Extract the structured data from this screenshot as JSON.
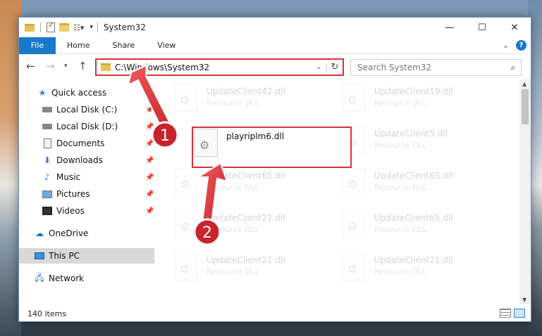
{
  "window": {
    "title": "System32",
    "controls": {
      "minimize": "—",
      "maximize": "☐",
      "close": "✕"
    }
  },
  "ribbon": {
    "file_tab": "File",
    "tabs": [
      "Home",
      "Share",
      "View"
    ],
    "help": "?"
  },
  "nav": {
    "address": "C:\\Windows\\System32",
    "search_placeholder": "Search System32"
  },
  "sidebar": {
    "items": [
      {
        "label": "Quick access",
        "icon": "star-icon",
        "pinned": false
      },
      {
        "label": "Local Disk (C:)",
        "icon": "drive-icon",
        "pinned": true
      },
      {
        "label": "Local Disk (D:)",
        "icon": "drive-icon",
        "pinned": true
      },
      {
        "label": "Documents",
        "icon": "document-icon",
        "pinned": true
      },
      {
        "label": "Downloads",
        "icon": "download-icon",
        "pinned": true
      },
      {
        "label": "Music",
        "icon": "music-icon",
        "pinned": true
      },
      {
        "label": "Pictures",
        "icon": "picture-icon",
        "pinned": true
      },
      {
        "label": "Videos",
        "icon": "video-icon",
        "pinned": true
      },
      {
        "label": "OneDrive",
        "icon": "cloud-icon",
        "pinned": false
      },
      {
        "label": "This PC",
        "icon": "computer-icon",
        "pinned": false,
        "selected": true
      },
      {
        "label": "Network",
        "icon": "network-icon",
        "pinned": false
      }
    ]
  },
  "files": [
    {
      "name": "UpdateClient42.dll",
      "type": "Resource DLL",
      "faded": true
    },
    {
      "name": "UpdateClient19.dll",
      "type": "Resource DLL",
      "faded": true
    },
    {
      "name": "playriplm6.dll",
      "type": "",
      "faded": false
    },
    {
      "name": "UpdateClient5.dll",
      "type": "Resource DLL",
      "faded": true
    },
    {
      "name": "UpdateClient65.dll",
      "type": "Resource DLL",
      "faded": true
    },
    {
      "name": "UpdateClient65.dll",
      "type": "Resource DLL",
      "faded": true
    },
    {
      "name": "UpdateClient21.dll",
      "type": "Resource DLL",
      "faded": true
    },
    {
      "name": "UpdateClient65.dll",
      "type": "Resource DLL",
      "faded": true
    },
    {
      "name": "UpdateClient21.dll",
      "type": "Resource DLL",
      "faded": true
    },
    {
      "name": "UpdateClient21.dll",
      "type": "Resource DLL",
      "faded": true
    }
  ],
  "status": {
    "item_count": "140 items"
  },
  "annotations": {
    "step1": "1",
    "step2": "2",
    "highlight_color": "#d7323b"
  }
}
